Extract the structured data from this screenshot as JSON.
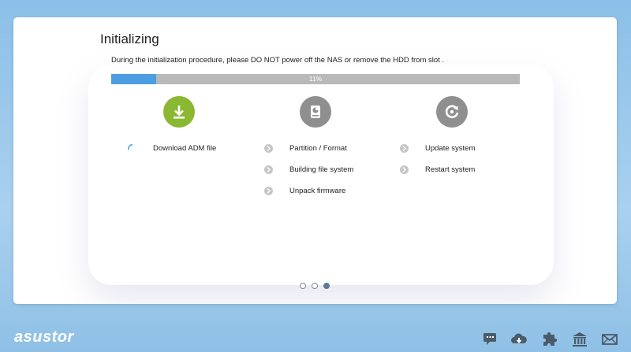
{
  "title": "Initializing",
  "description": "During the initialization procedure, please DO NOT power off the NAS or remove the HDD from slot .",
  "progress": {
    "percent": 11,
    "label": "11%"
  },
  "stages": [
    {
      "icon": "download-icon",
      "color": "#8ab832",
      "steps": [
        {
          "label": "Download ADM file",
          "status": "in-progress"
        }
      ]
    },
    {
      "icon": "disk-icon",
      "color": "#8f8f8f",
      "steps": [
        {
          "label": "Partition / Format",
          "status": "pending"
        },
        {
          "label": "Building file system",
          "status": "pending"
        },
        {
          "label": "Unpack firmware",
          "status": "pending"
        }
      ]
    },
    {
      "icon": "restart-icon",
      "color": "#8f8f8f",
      "steps": [
        {
          "label": "Update system",
          "status": "pending"
        },
        {
          "label": "Restart system",
          "status": "pending"
        }
      ]
    }
  ],
  "pager": {
    "pages": 3,
    "active": 3
  },
  "footer": {
    "logo": "asustor",
    "icons": [
      "chat-icon",
      "cloud-download-icon",
      "puzzle-icon",
      "bank-icon",
      "mail-icon"
    ]
  },
  "colors": {
    "accent": "#4c9de2",
    "download_green": "#8ab832",
    "inactive_gray": "#8f8f8f"
  }
}
